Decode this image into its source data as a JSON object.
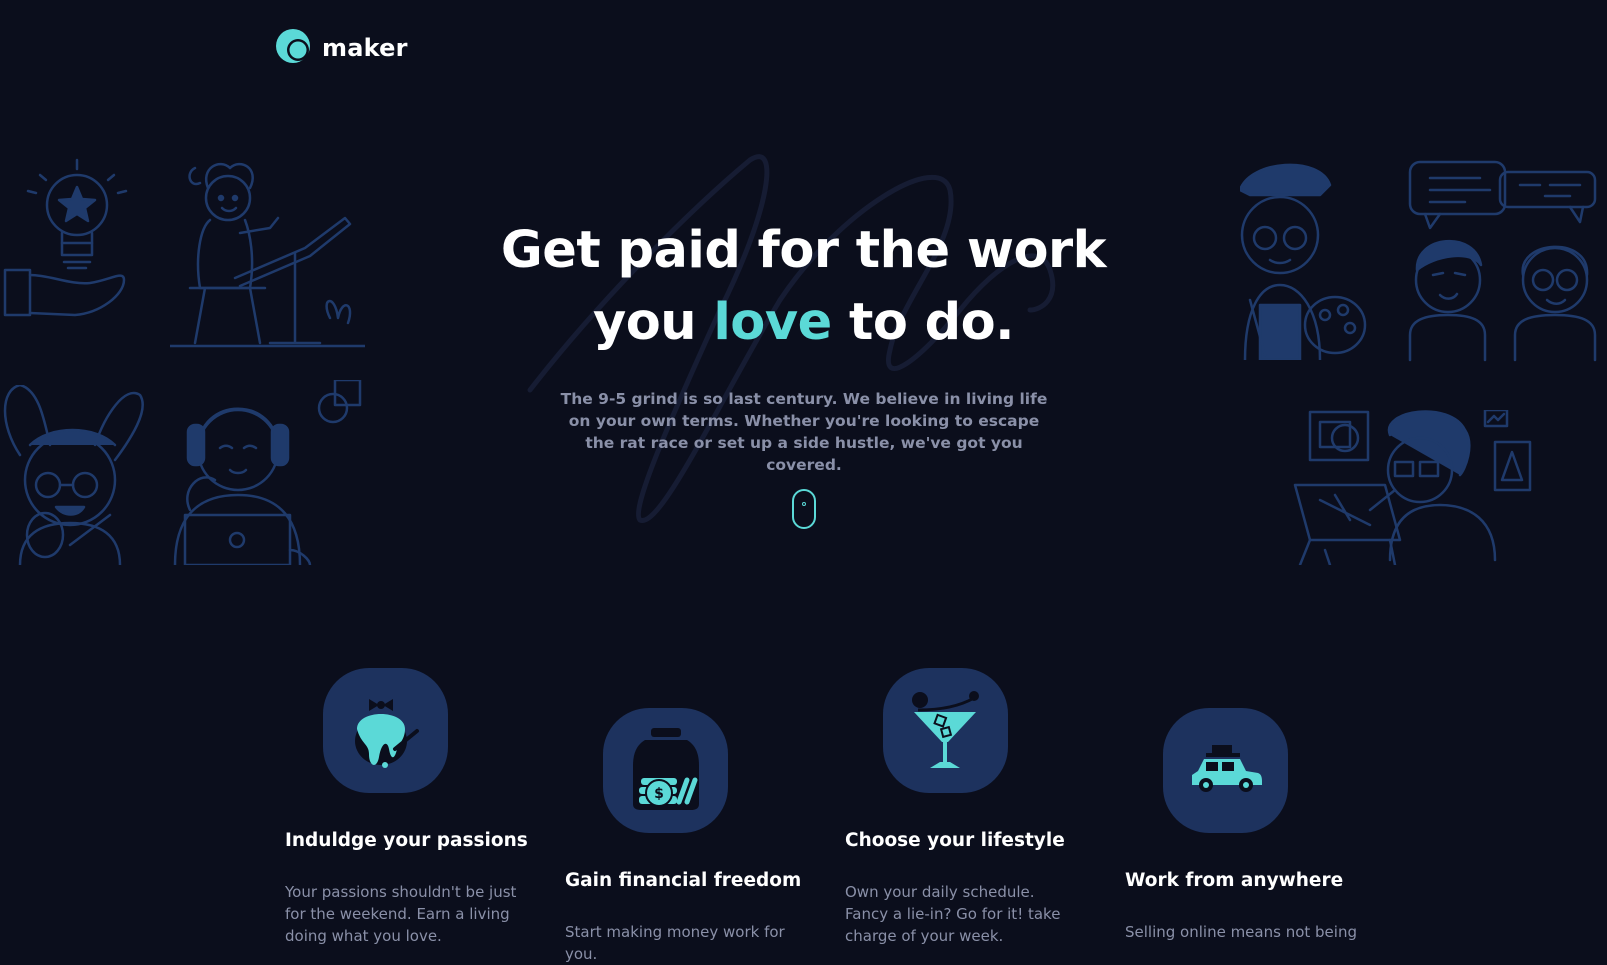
{
  "brand": {
    "name": "maker",
    "accent": "#5bd9d7"
  },
  "hero": {
    "title_line1": "Get paid for the work",
    "title_line2_pre": "you",
    "title_accent": "love",
    "title_line2_post": "to do.",
    "description": "The 9-5 grind is so last century. We believe in living life on your own terms. Whether you're looking to escape the rat race or set up a side hustle, we've got you covered."
  },
  "colors": {
    "background": "#0b0e1c",
    "tile": "#1d325e",
    "illustration": "#1f3a6b",
    "muted_text": "#8a90a8"
  },
  "features": [
    {
      "title": "Induldge your passions",
      "text": "Your passions shouldn't be just for the weekend. Earn a living doing what you love.",
      "icon": "paint-jar-icon"
    },
    {
      "title": "Gain financial freedom",
      "text": "Start making money work for you.",
      "icon": "coin-jar-icon"
    },
    {
      "title": "Choose your lifestyle",
      "text": "Own your daily schedule. Fancy a lie-in? Go for it! take charge of your week.",
      "icon": "cocktail-icon"
    },
    {
      "title": "Work from anywhere",
      "text": "Selling online means not being",
      "icon": "car-icon"
    }
  ]
}
